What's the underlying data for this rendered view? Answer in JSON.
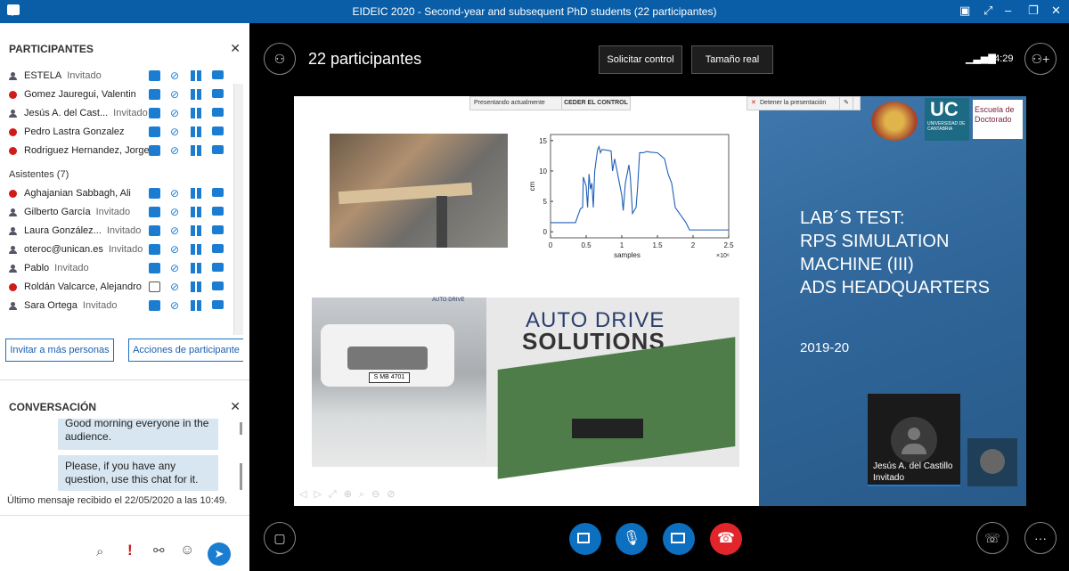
{
  "window": {
    "title": "EIDEIC 2020 - Second-year and subsequent PhD students (22 participantes)"
  },
  "participants_panel": {
    "heading": "PARTICIPANTES",
    "top_rows": [
      {
        "name": "ESTELA",
        "role": "Invitado",
        "status": "user"
      },
      {
        "name": "Gomez Jauregui, Valentin",
        "role": "",
        "status": "red"
      },
      {
        "name": "Jesús A. del Cast...",
        "role": "Invitado",
        "status": "user"
      },
      {
        "name": "Pedro Lastra Gonzalez",
        "role": "",
        "status": "red"
      },
      {
        "name": "Rodriguez Hernandez, Jorge",
        "role": "",
        "status": "red"
      }
    ],
    "attendees_heading": "Asistentes (7)",
    "attendees": [
      {
        "name": "Aghajanian Sabbagh, Ali",
        "role": "",
        "status": "red"
      },
      {
        "name": "Gilberto García",
        "role": "Invitado",
        "status": "user"
      },
      {
        "name": "Laura González...",
        "role": "Invitado",
        "status": "user"
      },
      {
        "name": "oteroc@unican.es",
        "role": "Invitado",
        "status": "user"
      },
      {
        "name": "Pablo",
        "role": "Invitado",
        "status": "user"
      },
      {
        "name": "Roldán Valcarce, Alejandro",
        "role": "",
        "status": "red"
      },
      {
        "name": "Sara Ortega",
        "role": "Invitado",
        "status": "user"
      }
    ],
    "invite_button": "Invitar a más personas",
    "actions_button": "Acciones de participante"
  },
  "conversation": {
    "heading": "CONVERSACIÓN",
    "messages": [
      "Good morning everyone in the audience.",
      "Please, if you have any question, use this chat for it."
    ],
    "last_message": "Último mensaje recibido el 22/05/2020 a las 10:49."
  },
  "meeting": {
    "participants_count": "22 participantes",
    "request_control": "Solicitar control",
    "actual_size": "Tamaño real",
    "timer": "54:29"
  },
  "slide": {
    "presenting_label": "Presentando actualmente",
    "cede_control": "CEDER EL CONTROL",
    "stop_presentation": "Detener la presentación",
    "title_lines": [
      "LAB´S TEST:",
      "RPS SIMULATION",
      "MACHINE (III)",
      "ADS HEADQUARTERS"
    ],
    "year": "2019-20",
    "uc_text": "UC",
    "uc_sub": "UNIVERSIDAD DE CANTABRIA",
    "escuela": "Escuela de Doctorado",
    "ads_logo_line1": "AUTO DRIVE",
    "ads_logo_line2": "SOLUTIONS",
    "plate": "S MB 4701",
    "chart_ylabel": "cm",
    "chart_xlabel": "samples",
    "chart_exp": "×10⁶",
    "chart_xticks": [
      "0",
      "0.5",
      "1",
      "1.5",
      "2",
      "2.5"
    ],
    "chart_yticks": [
      "15",
      "10",
      "5",
      "0"
    ]
  },
  "video_tile": {
    "name": "Jesús A. del Castillo",
    "role": "Invitado"
  },
  "chart_data": {
    "type": "line",
    "title": "",
    "xlabel": "samples",
    "ylabel": "cm",
    "xlim": [
      0,
      2.5
    ],
    "ylim": [
      -1,
      16
    ],
    "x": [
      0,
      0.35,
      0.38,
      0.42,
      0.45,
      0.46,
      0.5,
      0.52,
      0.54,
      0.56,
      0.58,
      0.6,
      0.62,
      0.66,
      0.68,
      0.7,
      0.72,
      0.75,
      0.85,
      0.87,
      0.9,
      0.95,
      1.0,
      1.02,
      1.05,
      1.1,
      1.12,
      1.15,
      1.2,
      1.22,
      1.25,
      1.3,
      1.35,
      1.4,
      1.5,
      1.6,
      1.62,
      1.65,
      1.7,
      1.75,
      1.9,
      1.95,
      2.0,
      2.5
    ],
    "series": [
      {
        "values": [
          1.5,
          1.5,
          2.5,
          3.8,
          4.0,
          9.0,
          7.5,
          4.0,
          9.5,
          7.0,
          8.0,
          4.0,
          10.0,
          13.5,
          14.0,
          13.0,
          13.5,
          13.5,
          13.3,
          10.0,
          12.0,
          9.0,
          6.0,
          3.5,
          8.0,
          11.0,
          9.0,
          3.0,
          4.0,
          7.0,
          13.0,
          13.0,
          13.2,
          13.1,
          13.0,
          12.0,
          11.0,
          9.5,
          8.0,
          4.0,
          1.5,
          0.3,
          0.3,
          0.3
        ]
      }
    ]
  }
}
